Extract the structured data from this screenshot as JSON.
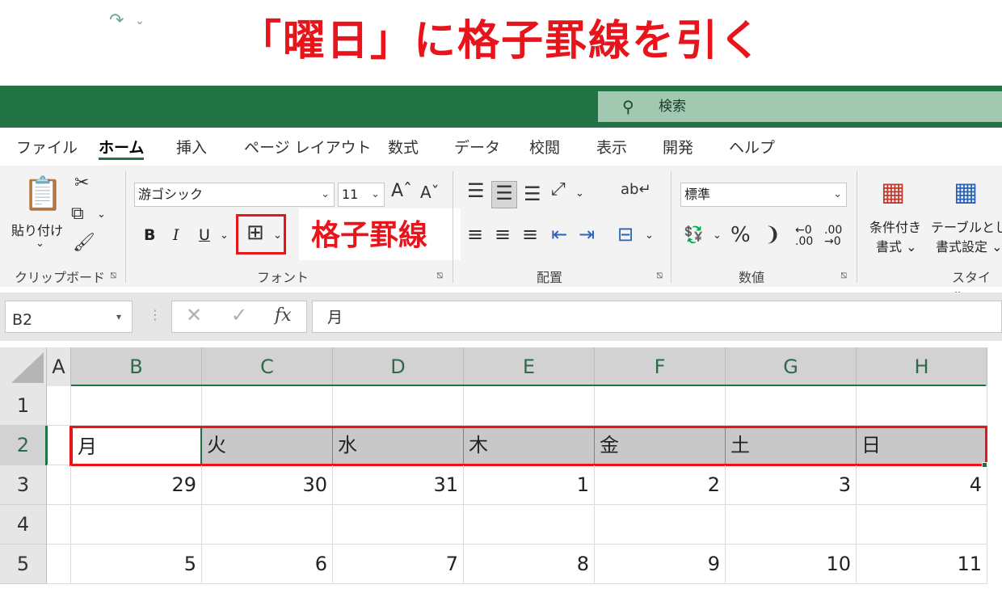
{
  "banner": {
    "title": "「曜日」に格子罫線を引く"
  },
  "qat": {
    "search_placeholder": "検索"
  },
  "tabs": [
    "ファイル",
    "ホーム",
    "挿入",
    "ページ レイアウト",
    "数式",
    "データ",
    "校閲",
    "表示",
    "開発",
    "ヘルプ"
  ],
  "active_tab": "ホーム",
  "ribbon": {
    "clipboard": {
      "paste_label": "貼り付け",
      "group_label": "クリップボード"
    },
    "font": {
      "font_name": "游ゴシック",
      "font_size": "11",
      "bold": "B",
      "italic": "I",
      "underline": "U",
      "group_label": "フォント"
    },
    "callout": "格子罫線",
    "alignment": {
      "group_label": "配置"
    },
    "number": {
      "format": "標準",
      "percent": "%",
      "comma": "❩",
      "group_label": "数値"
    },
    "styles": {
      "conditional": [
        "条件付き",
        "書式 ⌄"
      ],
      "table": [
        "テーブルとし",
        "書式設定 ⌄"
      ],
      "group_label": "スタイル"
    }
  },
  "formula_bar": {
    "name_box": "B2",
    "fx": "fx",
    "formula": "月"
  },
  "sheet": {
    "columns": [
      "A",
      "B",
      "C",
      "D",
      "E",
      "F",
      "G",
      "H"
    ],
    "rows": [
      "1",
      "2",
      "3",
      "4",
      "5"
    ],
    "weekdays": [
      "月",
      "火",
      "水",
      "木",
      "金",
      "土",
      "日"
    ],
    "row3": [
      "29",
      "30",
      "31",
      "1",
      "2",
      "3",
      "4"
    ],
    "row5": [
      "5",
      "6",
      "7",
      "8",
      "9",
      "10",
      "11"
    ]
  },
  "colors": {
    "excel_green": "#217346",
    "annotation_red": "#e8141b"
  }
}
